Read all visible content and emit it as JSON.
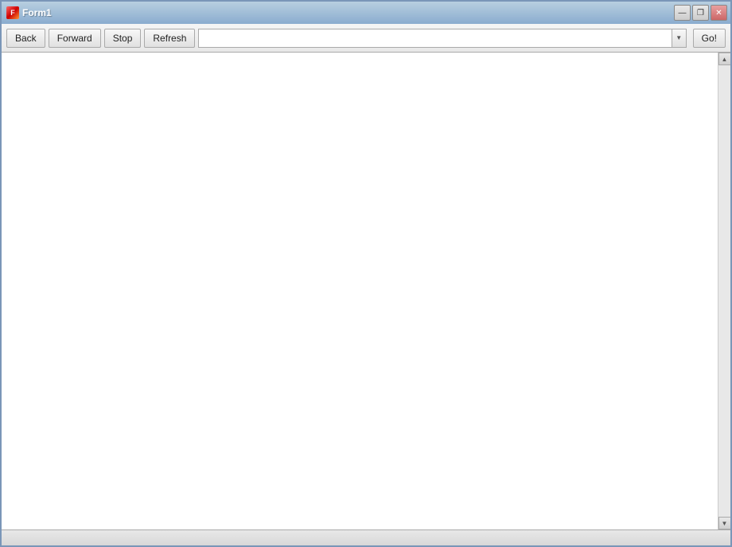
{
  "window": {
    "title": "Form1",
    "icon_label": "F"
  },
  "title_controls": {
    "minimize_label": "—",
    "maximize_label": "❐",
    "close_label": "✕"
  },
  "toolbar": {
    "back_label": "Back",
    "forward_label": "Forward",
    "stop_label": "Stop",
    "refresh_label": "Refresh",
    "go_label": "Go!",
    "address_placeholder": "",
    "dropdown_icon": "▼"
  },
  "content": {
    "empty": ""
  },
  "status": {
    "text": ""
  },
  "scrollbar": {
    "up_arrow": "▲",
    "down_arrow": "▼"
  }
}
